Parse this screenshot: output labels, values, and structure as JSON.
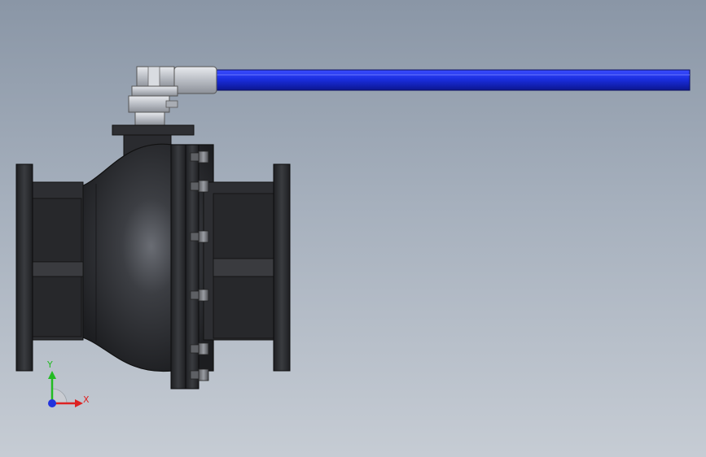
{
  "viewport": {
    "background_top": "#8a96a6",
    "background_bottom": "#c6ccd4"
  },
  "model": {
    "body_color": "#2b2c2f",
    "handle_color": "#1a2ee0",
    "stem_color": "#c8ccd2"
  },
  "triad": {
    "y_label": "Y",
    "x_label": "X",
    "y_color": "#22bb22",
    "x_color": "#dd2222",
    "z_color": "#2233dd"
  }
}
